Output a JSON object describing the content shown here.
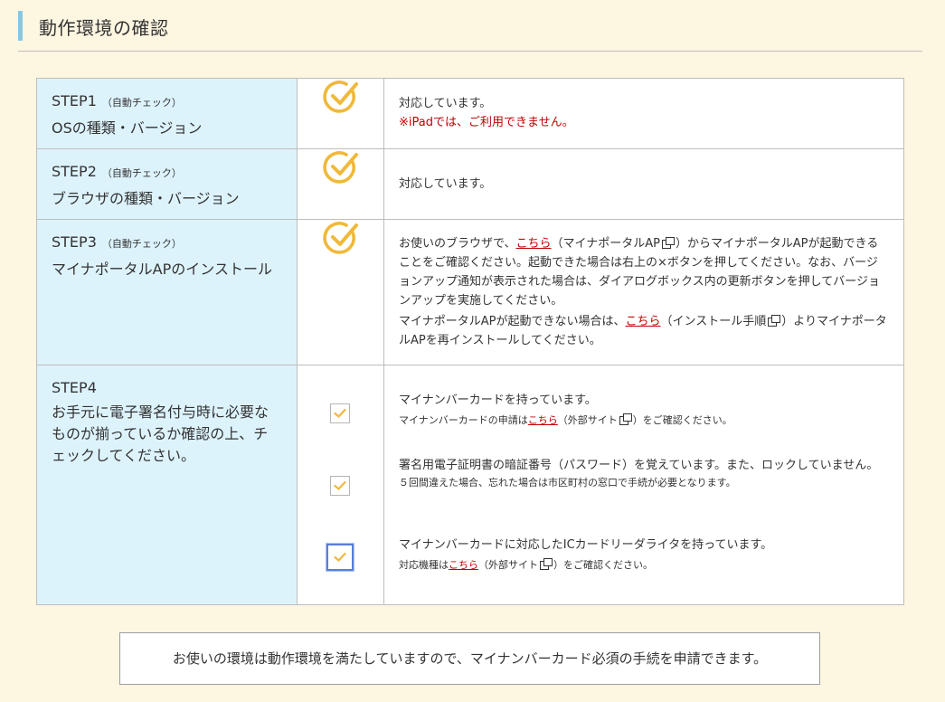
{
  "header": {
    "title": "動作環境の確認"
  },
  "step1": {
    "title": "STEP1",
    "auto": "（自動チェック）",
    "label": "OSの種類・バージョン",
    "status": "対応しています。",
    "note": "※iPadでは、ご利用できません。"
  },
  "step2": {
    "title": "STEP2",
    "auto": "（自動チェック）",
    "label": "ブラウザの種類・バージョン",
    "status": "対応しています。"
  },
  "step3": {
    "title": "STEP3",
    "auto": "（自動チェック）",
    "label": "マイナポータルAPのインストール",
    "p1_a": "お使いのブラウザで、",
    "p1_link": "こちら",
    "p1_b": "（マイナポータルAP",
    "p1_c": "）からマイナポータルAPが起動できることをご確認ください。起動できた場合は右上の×ボタンを押してください。なお、バージョンアップ通知が表示された場合は、ダイアログボックス内の更新ボタンを押してバージョンアップを実施してください。",
    "p2_a": "マイナポータルAPが起動できない場合は、",
    "p2_link": "こちら",
    "p2_b": "（インストール手順",
    "p2_c": "）よりマイナポータルAPを再インストールしてください。"
  },
  "step4": {
    "title": "STEP4",
    "label": "お手元に電子署名付与時に必要なものが揃っているか確認の上、チェックしてください。",
    "items": [
      {
        "main": "マイナンバーカードを持っています。",
        "sub_a": "マイナンバーカードの申請は",
        "sub_link": "こちら",
        "sub_b": "（外部サイト",
        "sub_c": "）をご確認ください。"
      },
      {
        "main": "署名用電子証明書の暗証番号（パスワード）を覚えています。また、ロックしていません。",
        "sub": "５回間違えた場合、忘れた場合は市区町村の窓口で手続が必要となります。"
      },
      {
        "main": "マイナンバーカードに対応したICカードリーダライタを持っています。",
        "sub_a": "対応機種は",
        "sub_link": "こちら",
        "sub_b": "（外部サイト",
        "sub_c": "）をご確認ください。"
      }
    ]
  },
  "notice": "お使いの環境は動作環境を満たしていますので、マイナンバーカード必須の手続を申請できます。",
  "colors": {
    "check": "#f0b93a",
    "label_bg": "#ddf3fc",
    "page_bg": "#fdf6e1",
    "link": "#c00000"
  },
  "icons": {
    "status_ok": "circle-check-icon",
    "checkbox": "checkbox-checked-icon",
    "external": "external-link-icon"
  }
}
